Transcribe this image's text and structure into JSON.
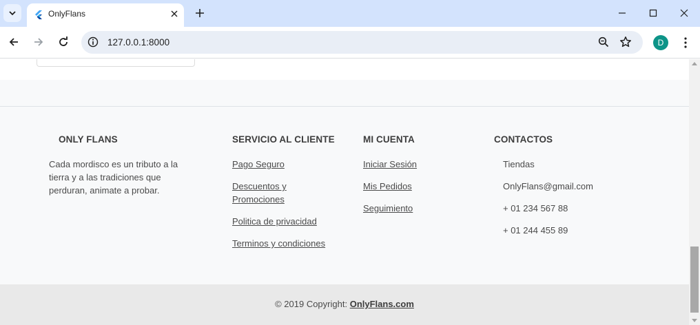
{
  "browser": {
    "tab_title": "OnlyFlans",
    "url": "127.0.0.1:8000",
    "avatar_letter": "D",
    "accent_color": "#0d9488"
  },
  "footer": {
    "brand": {
      "title": "ONLY FLANS",
      "description_lines": [
        "Cada mordisco es un tributo a la",
        "tierra y a las tradiciones que",
        "perduran, animate a probar."
      ]
    },
    "service": {
      "title": "SERVICIO AL CLIENTE",
      "links": [
        "Pago Seguro",
        "Descuentos y",
        "Promociones",
        "Politica de privacidad",
        "Terminos y condiciones"
      ]
    },
    "account": {
      "title": "MI CUENTA",
      "links": [
        "Iniciar Sesión",
        "Mis Pedidos",
        "Seguimiento"
      ]
    },
    "contacts": {
      "title": "CONTACTOS",
      "items": [
        "Tiendas",
        "OnlyFlans@gmail.com",
        "+ 01 234 567 88",
        "+ 01 244 455 89"
      ]
    }
  },
  "copyright": {
    "prefix": "© 2019 Copyright:",
    "link": "OnlyFlans.com"
  },
  "icons": [
    "tab-search-icon",
    "flutter-logo-icon",
    "close-icon",
    "plus-icon",
    "minimize-icon",
    "maximize-icon",
    "back-arrow-icon",
    "forward-arrow-icon",
    "reload-icon",
    "site-info-icon",
    "zoom-icon",
    "star-icon",
    "kebab-menu-icon"
  ]
}
